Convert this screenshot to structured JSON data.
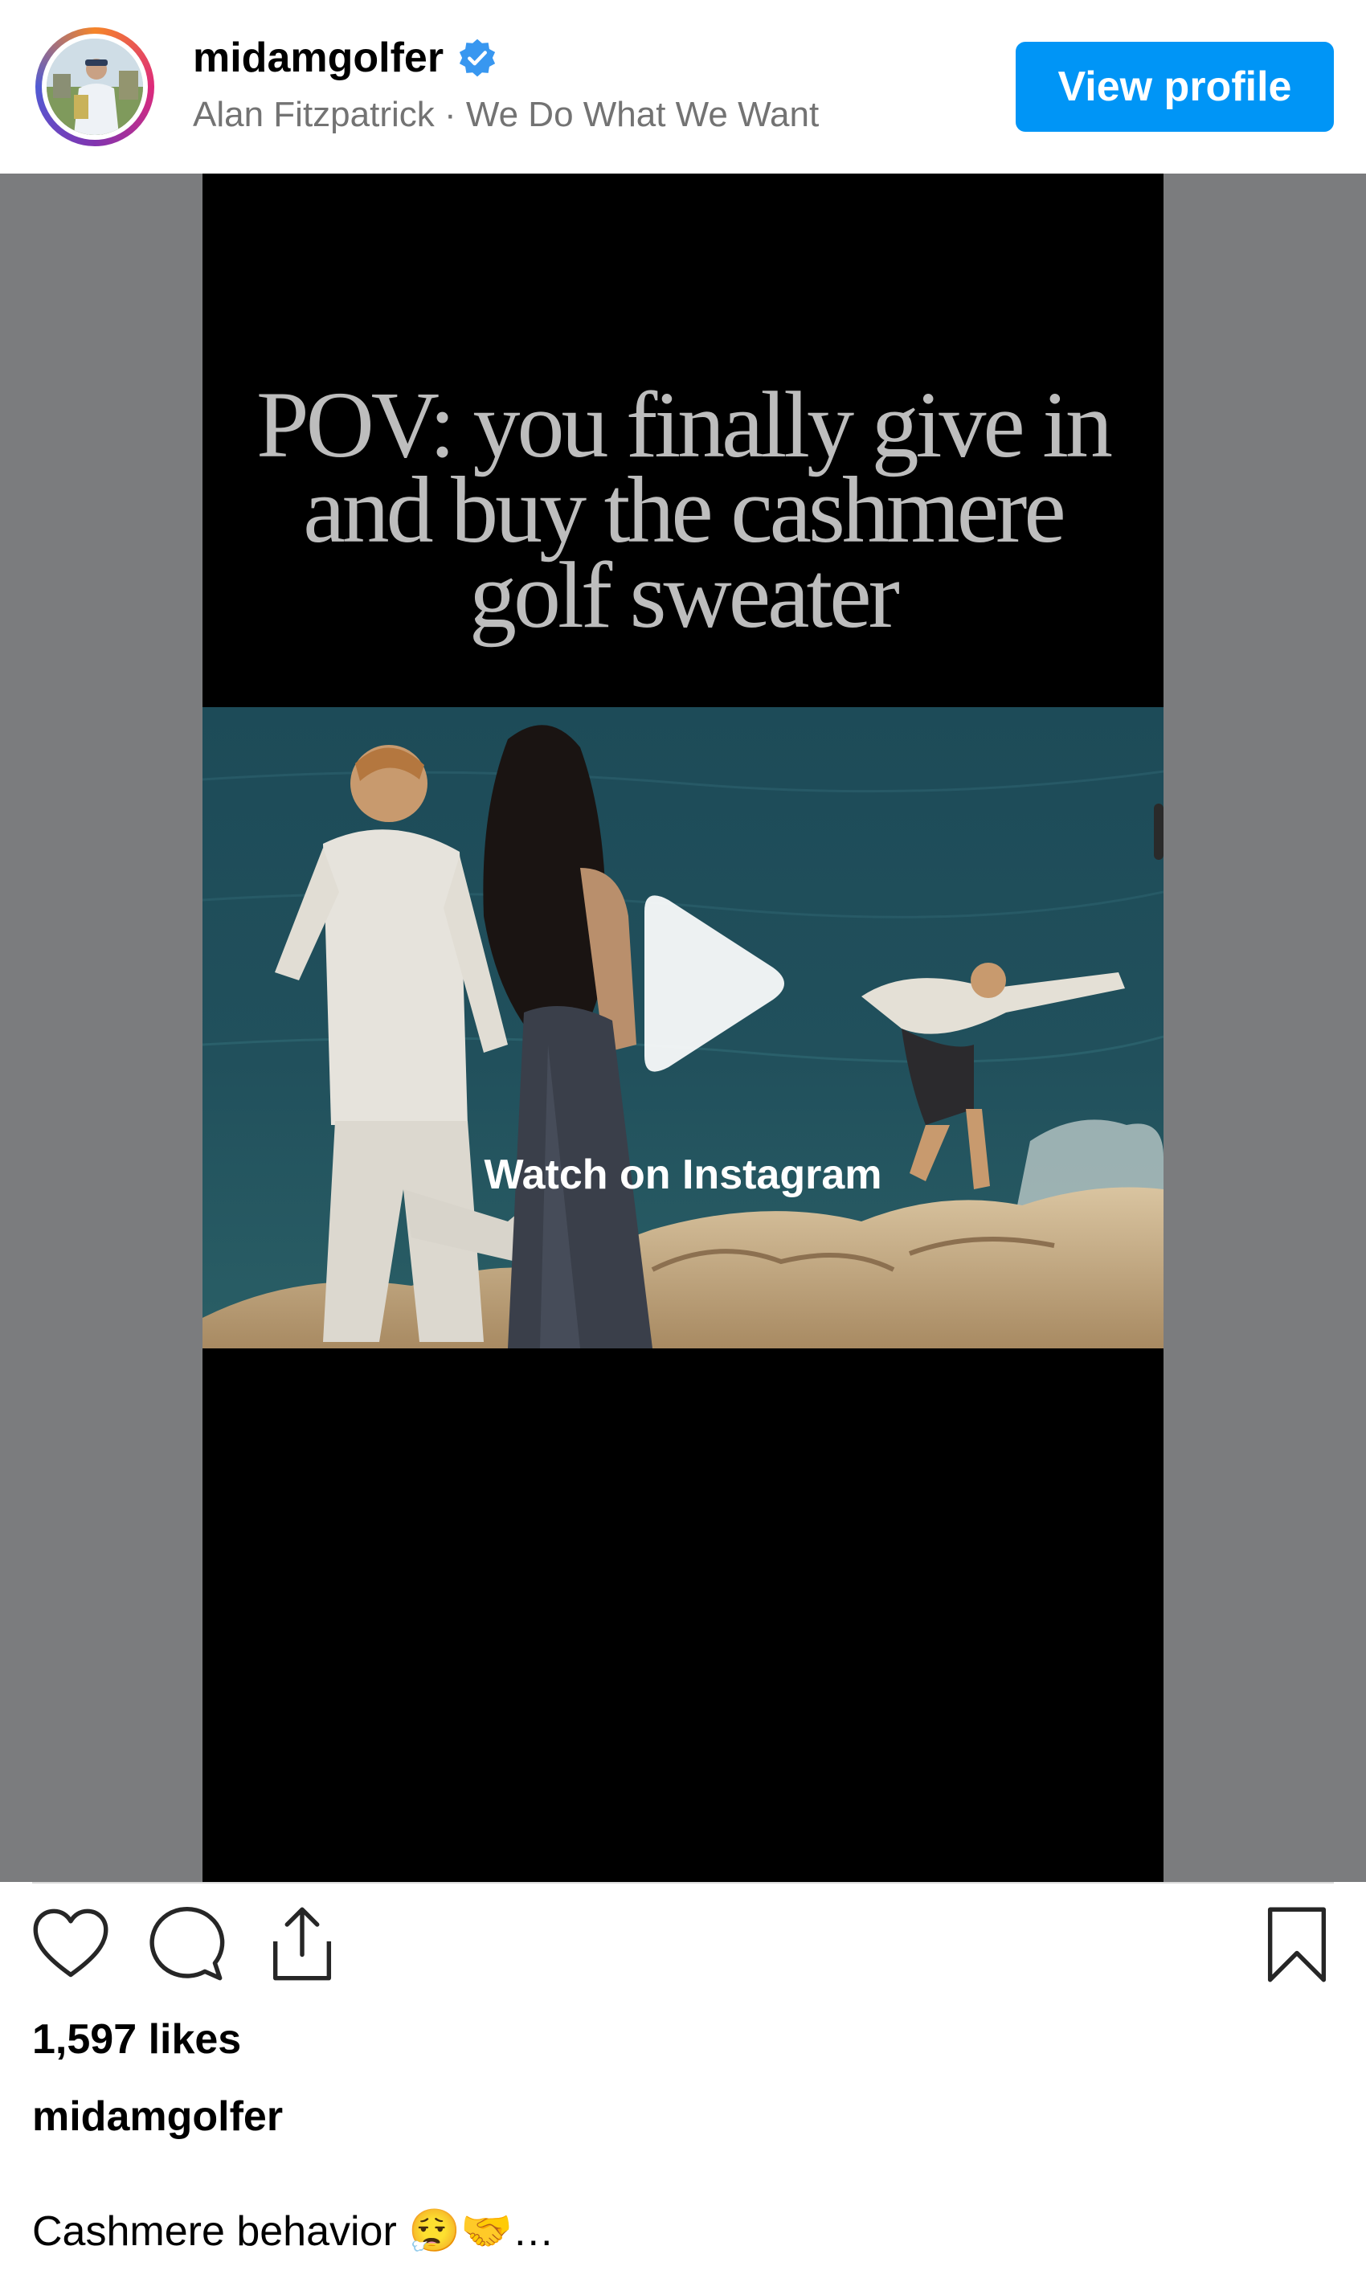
{
  "header": {
    "username": "midamgolfer",
    "subtitle": "Alan Fitzpatrick · We Do What We Want",
    "view_profile_label": "View profile",
    "verified_icon": "verified-badge-icon"
  },
  "video": {
    "caption_lines": [
      "POV: you finally give in",
      "and buy the cashmere",
      "golf sweater"
    ],
    "watch_label": "Watch on Instagram",
    "play_icon": "play-icon"
  },
  "actions": {
    "icons": [
      "heart-icon",
      "comment-icon",
      "share-icon",
      "bookmark-icon"
    ]
  },
  "post": {
    "likes": "1,597 likes",
    "caption_username": "midamgolfer",
    "caption_text": "Cashmere behavior 😮‍💨🤝…"
  },
  "colors": {
    "accent": "#0095f6",
    "media_background": "#7b7c7e",
    "secondary_text": "#737373"
  }
}
